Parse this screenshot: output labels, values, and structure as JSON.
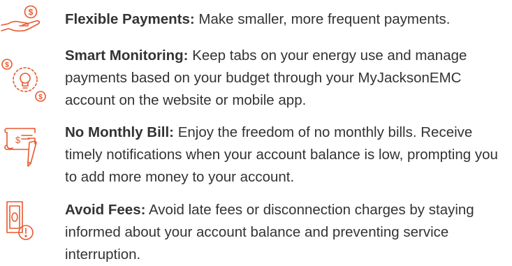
{
  "accent_color": "#e8582c",
  "features": [
    {
      "icon": "hand-dollar-icon",
      "title": "Flexible Payments:",
      "body": " Make smaller, more frequent payments."
    },
    {
      "icon": "lightbulb-dollar-icon",
      "title": "Smart Monitoring:",
      "body": " Keep tabs on your energy use and manage payments based on your budget through your MyJacksonEMC account on the website or mobile app."
    },
    {
      "icon": "bill-pencil-icon",
      "title": "No Monthly Bill:",
      "body": " Enjoy the freedom of no monthly bills. Receive timely notifications when your account balance is low, prompting you to add more money to your account."
    },
    {
      "icon": "money-alert-icon",
      "title": "Avoid Fees:",
      "body": " Avoid late fees or disconnection charges by staying informed about your account balance and preventing service interruption."
    }
  ]
}
